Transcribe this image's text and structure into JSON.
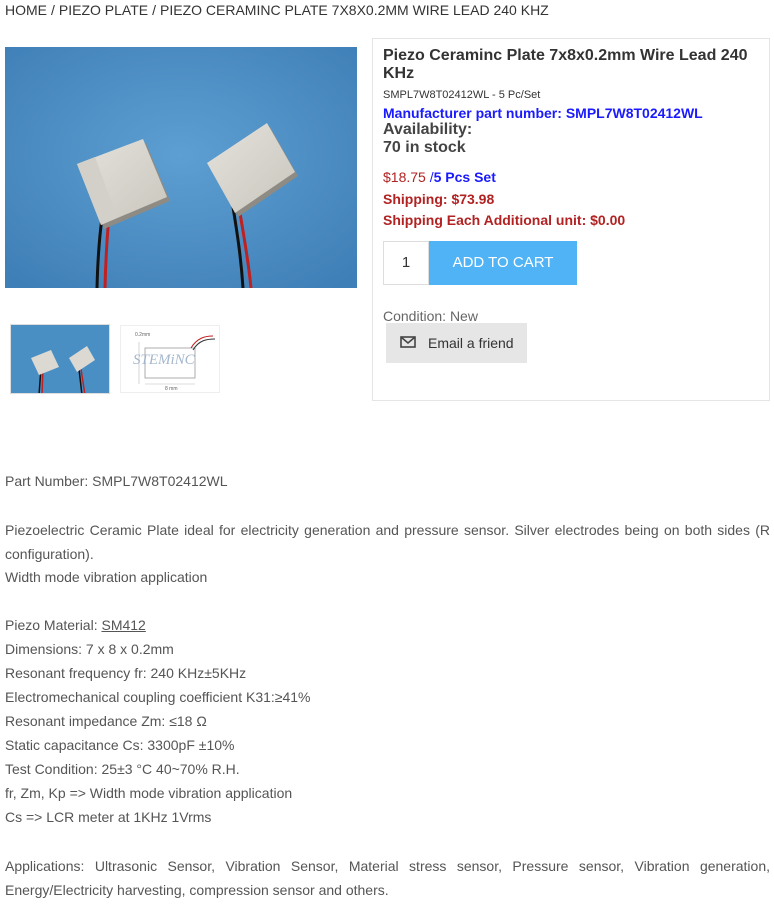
{
  "breadcrumb": {
    "home": "HOME",
    "category": "PIEZO PLATE",
    "current": "PIEZO CERAMINC PLATE 7X8X0.2MM WIRE LEAD 240 KHZ",
    "separator": "/"
  },
  "product": {
    "title": "Piezo Ceraminc Plate 7x8x0.2mm Wire Lead 240 KHz",
    "sku_line": "SMPL7W8T02412WL - 5 Pc/Set",
    "mfr_label": "Manufacturer part number:",
    "mfr_value": "SMPL7W8T02412WL",
    "availability_label": "Availability:",
    "stock": "70 in stock",
    "price": "$18.75",
    "per_prefix": " /",
    "per_unit": "5 Pcs Set",
    "shipping_label": "Shipping:",
    "shipping_value": "$73.98",
    "shipping_add_label": "Shipping Each Additional unit:",
    "shipping_add_value": "$0.00",
    "quantity": "1",
    "add_to_cart": "ADD TO CART",
    "condition_label": "Condition:",
    "condition_value": "New",
    "email_friend": "Email a friend"
  },
  "thumb2_logo": "STEMiNC",
  "description": {
    "part_number": "Part Number: SMPL7W8T02412WL",
    "intro": "Piezoelectric Ceramic Plate ideal for electricity generation and pressure sensor. Silver electrodes being on both sides (R configuration).",
    "intro2": "Width mode vibration application",
    "material_label": "Piezo Material: ",
    "material_link": "SM412",
    "specs": [
      "Dimensions: 7 x 8 x 0.2mm",
      "Resonant frequency fr: 240 KHz±5KHz",
      "Electromechanical coupling coefficient K31:≥41%",
      "Resonant impedance Zm: ≤18 Ω",
      "Static capacitance Cs: 3300pF ±10%",
      "Test Condition: 25±3 °C 40~70% R.H.",
      "fr, Zm, Kp => Width mode vibration application",
      "Cs => LCR meter at 1KHz 1Vrms"
    ],
    "applications": "Applications: Ultrasonic Sensor, Vibration Sensor, Material stress sensor, Pressure sensor, Vibration generation, Energy/Electricity harvesting, compression sensor and others."
  },
  "colors": {
    "accent_blue": "#4fb3f6",
    "price_red": "#b22222",
    "link_blue": "#1a1aff",
    "photo_bg": "#4a8fc4"
  }
}
